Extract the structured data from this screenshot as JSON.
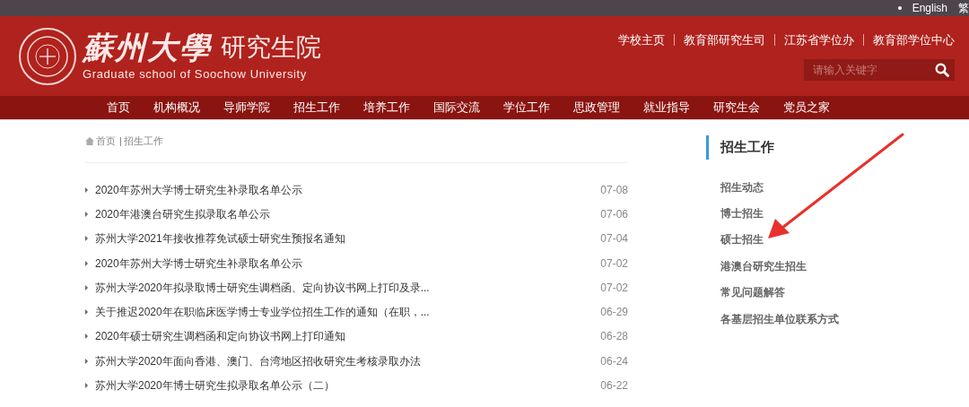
{
  "top_bar": {
    "links": [
      "English",
      "繁"
    ]
  },
  "header": {
    "logo_calligraphy": "蘇州大學",
    "logo_title": "研究生院",
    "logo_subtitle": "Graduate school of Soochow University",
    "quick_links": [
      "学校主页",
      "教育部研究生司",
      "江苏省学位办",
      "教育部学位中心"
    ],
    "search": {
      "placeholder": "请输入关键字"
    }
  },
  "nav": [
    "首页",
    "机构概况",
    "导师学院",
    "招生工作",
    "培养工作",
    "国际交流",
    "学位工作",
    "思政管理",
    "就业指导",
    "研究生会",
    "党员之家"
  ],
  "breadcrumb": [
    "首页",
    "招生工作"
  ],
  "news": [
    {
      "title": "2020年苏州大学博士研究生补录取名单公示",
      "date": "07-08"
    },
    {
      "title": "2020年港澳台研究生拟录取名单公示",
      "date": "07-06"
    },
    {
      "title": "苏州大学2021年接收推荐免试硕士研究生预报名通知",
      "date": "07-04"
    },
    {
      "title": "2020年苏州大学博士研究生补录取名单公示",
      "date": "07-02"
    },
    {
      "title": "苏州大学2020年拟录取博士研究生调档函、定向协议书网上打印及录...",
      "date": "07-02"
    },
    {
      "title": "关于推迟2020年在职临床医学博士专业学位招生工作的通知（在职，...",
      "date": "06-29"
    },
    {
      "title": "2020年硕士研究生调档函和定向协议书网上打印通知",
      "date": "06-28"
    },
    {
      "title": "苏州大学2020年面向香港、澳门、台湾地区招收研究生考核录取办法",
      "date": "06-24"
    },
    {
      "title": "苏州大学2020年博士研究生拟录取名单公示（二）",
      "date": "06-22"
    }
  ],
  "sidebar": {
    "title": "招生工作",
    "items": [
      "招生动态",
      "博士招生",
      "硕士招生",
      "港澳台研究生招生",
      "常见问题解答",
      "各基层招生单位联系方式"
    ]
  }
}
